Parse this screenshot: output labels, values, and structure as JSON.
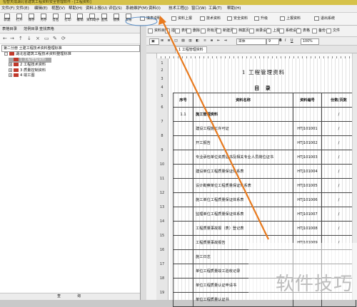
{
  "window": {
    "title": "恒智天成湖北省建筑工程资料安全管理软件 - [工程资料]"
  },
  "menu": [
    "文件(F)",
    "文件(E)",
    "编辑(E)",
    "视图(V)",
    "帮助(H)",
    "资料上报(U)",
    "评估(S)",
    "系统维护(M)",
    "资料(I)",
    "技术工程(J)",
    "窗口(W)",
    "工具(T)",
    "帮助(H)"
  ],
  "toolbar": [
    {
      "label": "新建",
      "icon": "new-icon"
    },
    {
      "label": "打开",
      "icon": "open-icon"
    },
    {
      "label": "保存",
      "icon": "save-icon"
    },
    {
      "label": "另存",
      "icon": "saveas-icon"
    },
    {
      "label": "签名",
      "icon": "sign-icon"
    },
    {
      "label": "打印",
      "icon": "print-icon"
    },
    {
      "label": "撤销",
      "icon": "undo-icon"
    },
    {
      "label": "资料助手",
      "icon": "helper-icon"
    },
    {
      "label": "查找",
      "icon": "find-icon"
    },
    {
      "label": "替换",
      "icon": "replace-icon"
    },
    {
      "label": "表格",
      "icon": "table-icon"
    }
  ],
  "toolbar_right": [
    "填表说明",
    "资料上报",
    "技术资料",
    "安全资料",
    "升级",
    "上报资料",
    "退出系统"
  ],
  "left_panel": {
    "tabs": [
      "表格目录",
      "范例目录",
      "查找表格"
    ],
    "path": "第二分册 土建工程技术资料整理标准",
    "tree": [
      {
        "label": "湖北省建筑工程技术资料整理标准",
        "level": 0,
        "expand": "-",
        "selected": false
      },
      {
        "label": "1 工程管理资料",
        "level": 1,
        "expand": "",
        "selected": true
      },
      {
        "label": "2 工程技术资料",
        "level": 1,
        "expand": "+",
        "selected": false
      },
      {
        "label": "3 质量控制资料",
        "level": 1,
        "expand": "+",
        "selected": false
      },
      {
        "label": "4 竣工图",
        "level": 1,
        "expand": "+",
        "selected": false
      }
    ],
    "bottom": [
      "查",
      "询"
    ]
  },
  "ribbon": [
    "资料目录",
    "插入",
    "表格",
    "删除",
    "所有页",
    "新建页",
    "档案页",
    "目录设置",
    "上报",
    "系统设置",
    "表格",
    "备份",
    "文件"
  ],
  "format_bar": {
    "font": "宋体",
    "size": "9",
    "zoom": "100%"
  },
  "doc_tab": "1 工程管理资料",
  "document": {
    "title": "1  工程管理资料",
    "subtitle": "目  录",
    "headers": [
      "序号",
      "资料名称",
      "资料编号",
      "份数/页数"
    ],
    "rows": [
      {
        "no": "1.1",
        "name": "施工管理资料",
        "code": "",
        "pages": "/",
        "bold": true
      },
      {
        "no": "",
        "name": "建设工程施工许可证",
        "code": "HTJ101001",
        "pages": "/"
      },
      {
        "no": "",
        "name": "开工报告",
        "code": "HTJ101002",
        "pages": "/"
      },
      {
        "no": "",
        "name": "专业承包单位资质证书及相关专业人员岗位证书",
        "code": "HTJ101003",
        "pages": "/"
      },
      {
        "no": "",
        "name": "建设单位工程质量保证体系表",
        "code": "HTJ101004",
        "pages": "/"
      },
      {
        "no": "",
        "name": "设计勘察单位工程质量保证体系表",
        "code": "HTJ101005",
        "pages": "/"
      },
      {
        "no": "",
        "name": "施工单位工程质量保证体系表",
        "code": "HTJ101006",
        "pages": "/"
      },
      {
        "no": "",
        "name": "监理单位工程质量保证体系表",
        "code": "HTJ101007",
        "pages": "/"
      },
      {
        "no": "",
        "name": "工程质量事故报（表）登记表",
        "code": "HTJ101008",
        "pages": "/"
      },
      {
        "no": "",
        "name": "工程质量事故报告",
        "code": "HTJ101009",
        "pages": "/"
      },
      {
        "no": "",
        "name": "施工日志",
        "code": "",
        "pages": ""
      },
      {
        "no": "",
        "name": "单位工程质量竣工验收记录",
        "code": "",
        "pages": ""
      },
      {
        "no": "",
        "name": "单位工程质量认证申请书",
        "code": "",
        "pages": ""
      },
      {
        "no": "",
        "name": "单位工程质量认证书",
        "code": "",
        "pages": ""
      }
    ],
    "row_numbers": [
      "1",
      "2",
      "3",
      "4",
      "5",
      "6",
      "7",
      "8",
      "9",
      "10",
      "11",
      "12",
      "13",
      "14",
      "15",
      "16",
      "17",
      "18",
      "19"
    ]
  },
  "watermark": "软件技巧",
  "arrow": {
    "color": "#e87a1e"
  }
}
